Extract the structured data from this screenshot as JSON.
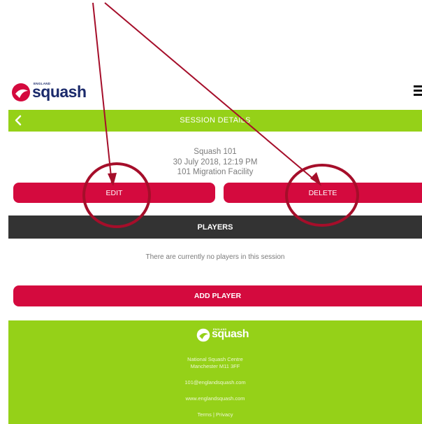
{
  "header": {
    "logo_small": "ENGLAND",
    "logo_word": "squash",
    "menu_icon": "hamburger-icon"
  },
  "top_bar": {
    "title": "SESSION DETAILS",
    "back_icon": "chevron-left-icon"
  },
  "session": {
    "name": "Squash 101",
    "datetime": "30 July 2018, 12:19 PM",
    "venue": "101 Migration Facility"
  },
  "actions": {
    "edit_label": "EDIT",
    "delete_label": "DELETE"
  },
  "players": {
    "title": "PLAYERS",
    "empty_message": "There are currently no players in this session",
    "add_label": "ADD PLAYER"
  },
  "footer": {
    "logo_small": "ENGLAND",
    "logo_word": "squash",
    "address_line1": "National Squash Centre",
    "address_line2": "Manchester M11 3FF",
    "email": "101@englandsquash.com",
    "website": "www.englandsquash.com",
    "links": "Terms | Privacy"
  },
  "colors": {
    "brand_green": "#95d118",
    "brand_red": "#d40a3e",
    "dark_bar": "#333333",
    "annotation": "#a50e2a",
    "logo_navy": "#1b2a6b"
  }
}
